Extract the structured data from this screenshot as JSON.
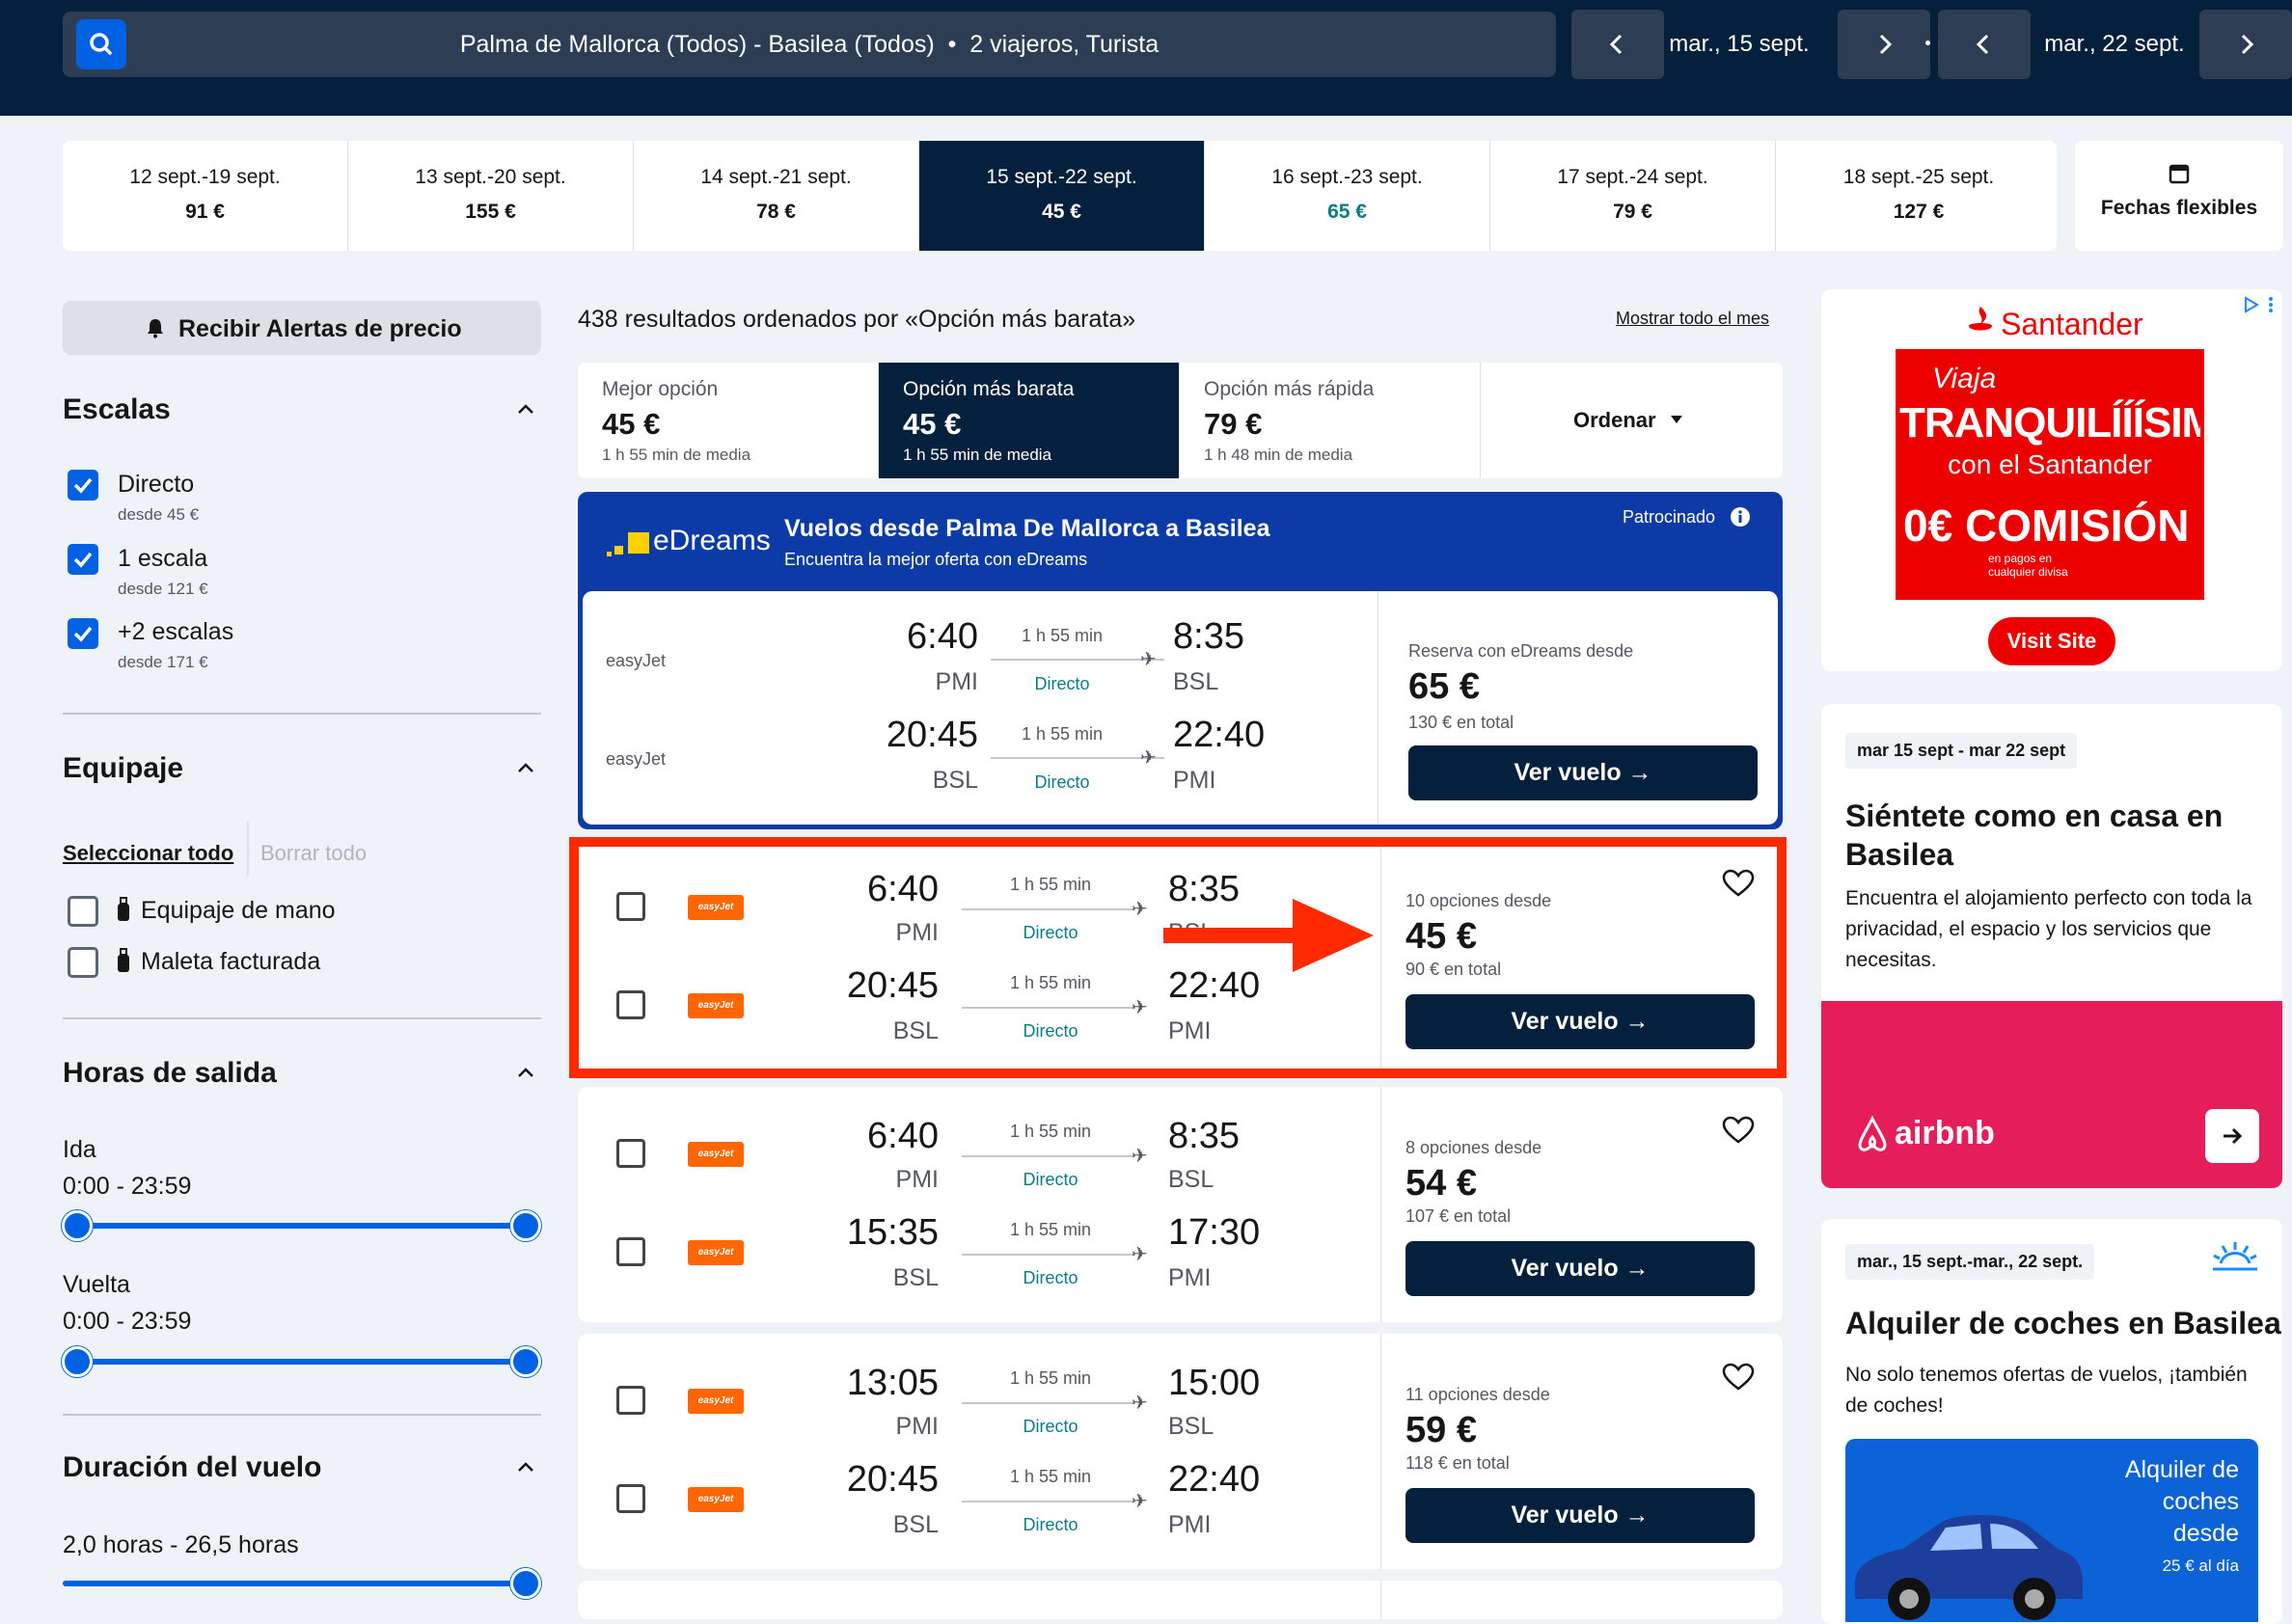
{
  "search": {
    "route": "Palma de Mallorca (Todos) - Basilea (Todos)",
    "travellers": "2 viajeros, Turista",
    "depart": "mar., 15 sept.",
    "return": "mar., 22 sept."
  },
  "dates": [
    {
      "range": "12 sept.-19 sept.",
      "price": "91 €"
    },
    {
      "range": "13 sept.-20 sept.",
      "price": "155 €"
    },
    {
      "range": "14 sept.-21 sept.",
      "price": "78 €"
    },
    {
      "range": "15 sept.-22 sept.",
      "price": "45 €"
    },
    {
      "range": "16 sept.-23 sept.",
      "price": "65 €"
    },
    {
      "range": "17 sept.-24 sept.",
      "price": "79 €"
    },
    {
      "range": "18 sept.-25 sept.",
      "price": "127 €"
    }
  ],
  "flexible": "Fechas flexibles",
  "sidebar": {
    "alert": "Recibir Alertas de precio",
    "stops_title": "Escalas",
    "stops": [
      {
        "label": "Directo",
        "sub": "desde 45 €"
      },
      {
        "label": "1 escala",
        "sub": "desde 121 €"
      },
      {
        "label": "+2 escalas",
        "sub": "desde 171 €"
      }
    ],
    "baggage_title": "Equipaje",
    "select_all": "Seleccionar todo",
    "clear_all": "Borrar todo",
    "baggage": [
      "Equipaje de mano",
      "Maleta facturada"
    ],
    "times_title": "Horas de salida",
    "outbound": "Ida",
    "outbound_range": "0:00 - 23:59",
    "return": "Vuelta",
    "return_range": "0:00 - 23:59",
    "duration_title": "Duración del vuelo",
    "duration_range": "2,0 horas - 26,5 horas"
  },
  "results": {
    "summary": "438 resultados ordenados por «Opción más barata»",
    "show_month": "Mostrar todo el mes",
    "tabs": [
      {
        "label": "Mejor opción",
        "price": "45 €",
        "dur": "1 h 55 min de media"
      },
      {
        "label": "Opción más barata",
        "price": "45 €",
        "dur": "1 h 55 min de media"
      },
      {
        "label": "Opción más rápida",
        "price": "79 €",
        "dur": "1 h 48 min de media"
      }
    ],
    "sort": "Ordenar"
  },
  "sponsored": {
    "brand": "eDreams",
    "title": "Vuelos desde Palma De Mallorca a Basilea",
    "subtitle": "Encuentra la mejor oferta con eDreams",
    "tag": "Patrocinado",
    "airline": "easyJet",
    "legs": [
      {
        "dep": "6:40",
        "from": "PMI",
        "dur": "1 h 55 min",
        "dir": "Directo",
        "arr": "8:35",
        "to": "BSL"
      },
      {
        "dep": "20:45",
        "from": "BSL",
        "dur": "1 h 55 min",
        "dir": "Directo",
        "arr": "22:40",
        "to": "PMI"
      }
    ],
    "from_label": "Reserva con eDreams desde",
    "price": "65 €",
    "total": "130 € en total",
    "button": "Ver vuelo"
  },
  "cards": [
    {
      "opts": "10 opciones desde",
      "price": "45 €",
      "total": "90 € en total",
      "button": "Ver vuelo",
      "legs": [
        {
          "dep": "6:40",
          "from": "PMI",
          "dur": "1 h 55 min",
          "dir": "Directo",
          "arr": "8:35",
          "to": "BSL"
        },
        {
          "dep": "20:45",
          "from": "BSL",
          "dur": "1 h 55 min",
          "dir": "Directo",
          "arr": "22:40",
          "to": "PMI"
        }
      ]
    },
    {
      "opts": "8 opciones desde",
      "price": "54 €",
      "total": "107 € en total",
      "button": "Ver vuelo",
      "legs": [
        {
          "dep": "6:40",
          "from": "PMI",
          "dur": "1 h 55 min",
          "dir": "Directo",
          "arr": "8:35",
          "to": "BSL"
        },
        {
          "dep": "15:35",
          "from": "BSL",
          "dur": "1 h 55 min",
          "dir": "Directo",
          "arr": "17:30",
          "to": "PMI"
        }
      ]
    },
    {
      "opts": "11 opciones desde",
      "price": "59 €",
      "total": "118 € en total",
      "button": "Ver vuelo",
      "legs": [
        {
          "dep": "13:05",
          "from": "PMI",
          "dur": "1 h 55 min",
          "dir": "Directo",
          "arr": "15:00",
          "to": "BSL"
        },
        {
          "dep": "20:45",
          "from": "BSL",
          "dur": "1 h 55 min",
          "dir": "Directo",
          "arr": "22:40",
          "to": "PMI"
        }
      ]
    }
  ],
  "logo_text": "easyJet",
  "ads": {
    "santander": {
      "brand": "Santander",
      "line1": "Viaja",
      "line2": "TRANQUILÍÍÍSIMX",
      "line3": "con el Santander",
      "line4": "0€ COMISIÓN",
      "line5": "en pagos en cualquier divisa",
      "cta": "Visit Site"
    },
    "airbnb": {
      "dates": "mar 15 sept - mar 22 sept",
      "title": "Siéntete como en casa en Basilea",
      "body": "Encuentra el alojamiento perfecto con toda la privacidad, el espacio y los servicios que necesitas.",
      "brand": "airbnb"
    },
    "cars": {
      "dates": "mar., 15 sept.-mar., 22 sept.",
      "title": "Alquiler de coches en Basilea",
      "body": "No solo tenemos ofertas de vuelos, ¡también de coches!",
      "promo1": "Alquiler de",
      "promo2": "coches",
      "promo3": "desde",
      "promo4": "25 € al día"
    }
  },
  "colors": {
    "navy": "#05203c",
    "blue": "#0062e3",
    "highlight": "#ff2a00",
    "teal": "#0b7c86"
  }
}
